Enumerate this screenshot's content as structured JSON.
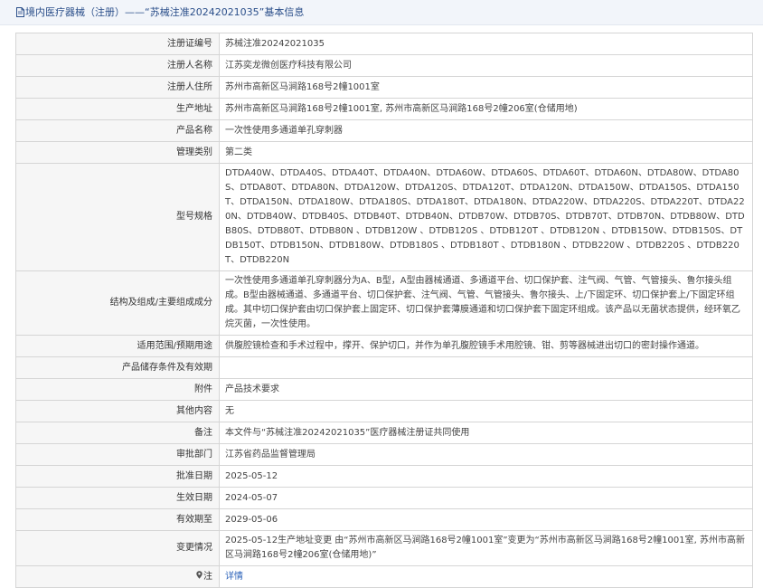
{
  "header": {
    "title": "境内医疗器械（注册）——“苏械注准20242021035”基本信息"
  },
  "rows": [
    {
      "label": "注册证编号",
      "value": "苏械注准20242021035"
    },
    {
      "label": "注册人名称",
      "value": "江苏奕龙微创医疗科技有限公司"
    },
    {
      "label": "注册人住所",
      "value": "苏州市高新区马涧路168号2幢1001室"
    },
    {
      "label": "生产地址",
      "value": "苏州市高新区马涧路168号2幢1001室, 苏州市高新区马涧路168号2幢206室(仓储用地)"
    },
    {
      "label": "产品名称",
      "value": "一次性使用多通道单孔穿刺器"
    },
    {
      "label": "管理类别",
      "value": "第二类"
    },
    {
      "label": "型号规格",
      "value": "DTDA40W、DTDA40S、DTDA40T、DTDA40N、DTDA60W、DTDA60S、DTDA60T、DTDA60N、DTDA80W、DTDA80S、DTDA80T、DTDA80N、DTDA120W、DTDA120S、DTDA120T、DTDA120N、DTDA150W、DTDA150S、DTDA150T、DTDA150N、DTDA180W、DTDA180S、DTDA180T、DTDA180N、DTDA220W、DTDA220S、DTDA220T、DTDA220N、DTDB40W、DTDB40S、DTDB40T、DTDB40N、DTDB70W、DTDB70S、DTDB70T、DTDB70N、DTDB80W、DTDB80S、DTDB80T、DTDB80N 、DTDB120W 、DTDB120S 、DTDB120T 、DTDB120N 、DTDB150W、DTDB150S、DTDB150T、DTDB150N、DTDB180W、DTDB180S 、DTDB180T 、DTDB180N 、DTDB220W 、DTDB220S 、DTDB220T、DTDB220N"
    },
    {
      "label": "结构及组成/主要组成成分",
      "value": "一次性使用多通道单孔穿刺器分为A、B型，A型由器械通道、多通道平台、切口保护套、注气阀、气管、气管接头、鲁尔接头组成。B型由器械通道、多通道平台、切口保护套、注气阀、气管、气管接头、鲁尔接头、上/下固定环、切口保护套上/下固定环组成。其中切口保护套由切口保护套上固定环、切口保护套薄膜通道和切口保护套下固定环组成。该产品以无菌状态提供，经环氧乙烷灭菌，一次性使用。"
    },
    {
      "label": "适用范围/预期用途",
      "value": "供腹腔镜检查和手术过程中，撑开、保护切口，并作为单孔腹腔镜手术用腔镜、钳、剪等器械进出切口的密封操作通道。"
    },
    {
      "label": "产品储存条件及有效期",
      "value": ""
    },
    {
      "label": "附件",
      "value": "产品技术要求"
    },
    {
      "label": "其他内容",
      "value": "无"
    },
    {
      "label": "备注",
      "value": "本文件与“苏械注准20242021035”医疗器械注册证共同使用"
    },
    {
      "label": "审批部门",
      "value": "江苏省药品监督管理局"
    },
    {
      "label": "批准日期",
      "value": "2025-05-12"
    },
    {
      "label": "生效日期",
      "value": "2024-05-07"
    },
    {
      "label": "有效期至",
      "value": "2029-05-06"
    },
    {
      "label": "变更情况",
      "value": "2025-05-12生产地址变更 由“苏州市高新区马涧路168号2幢1001室”变更为“苏州市高新区马涧路168号2幢1001室, 苏州市高新区马涧路168号2幢206室(仓储用地)”"
    },
    {
      "label": "注",
      "value": "详情"
    }
  ],
  "icons": {
    "header_icon": "document-icon",
    "note_icon": "map-pin-icon"
  }
}
